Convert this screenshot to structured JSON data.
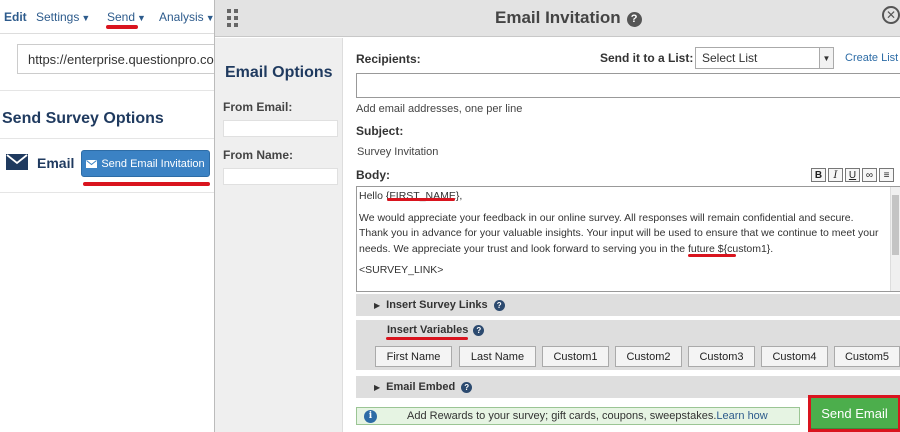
{
  "background": {
    "nav": {
      "edit": "Edit",
      "settings": "Settings",
      "send": "Send",
      "analysis": "Analysis"
    },
    "url_text": "https://enterprise.questionpro.com",
    "section_title": "Send Survey Options",
    "email_label": "Email",
    "send_invitation_button": "Send Email Invitation"
  },
  "modal": {
    "title": "Email Invitation",
    "left_panel": {
      "title": "Email Options",
      "from_email_label": "From Email:",
      "from_name_label": "From Name:"
    },
    "recipients_label": "Recipients:",
    "send_to_list_label": "Send it to a List:",
    "list_select_value": "Select List",
    "create_list_link": "Create List",
    "recipients_hint": "Add email addresses, one per line",
    "subject_label": "Subject:",
    "subject_value": "Survey Invitation",
    "body_label": "Body:",
    "toolbar": {
      "bold": "B",
      "italic": "I",
      "underline": "U",
      "link": "∞",
      "align": "≡"
    },
    "body": {
      "greeting_prefix": "Hello ",
      "greeting_var": "{FIRST_NAME}",
      "greeting_suffix": ",",
      "paragraph_1": "We would appreciate your feedback in our online survey.  All responses will remain confidential and secure.  Thank you in advance for your valuable insights.  Your input will be used to ensure that we continue to meet your needs.  We appreciate your trust and look forward to serving you in the future $",
      "paragraph_1_var": "{custom1}",
      "paragraph_1_suffix": ".",
      "survey_link": "<SURVEY_LINK>"
    },
    "insert_survey_links": "Insert Survey Links",
    "insert_variables": {
      "title": "Insert Variables",
      "buttons": [
        "First Name",
        "Last Name",
        "Custom1",
        "Custom2",
        "Custom3",
        "Custom4",
        "Custom5"
      ]
    },
    "email_embed": "Email Embed",
    "rewards": {
      "text": "Add Rewards to your survey; gift cards, coupons, sweepstakes.",
      "link": "Learn how"
    },
    "send_email_button": "Send Email"
  },
  "colors": {
    "highlight_red": "#d9141e",
    "send_green": "#4cae4c",
    "primary_blue": "#3b82c4",
    "heading_navy": "#1f3a5f"
  }
}
